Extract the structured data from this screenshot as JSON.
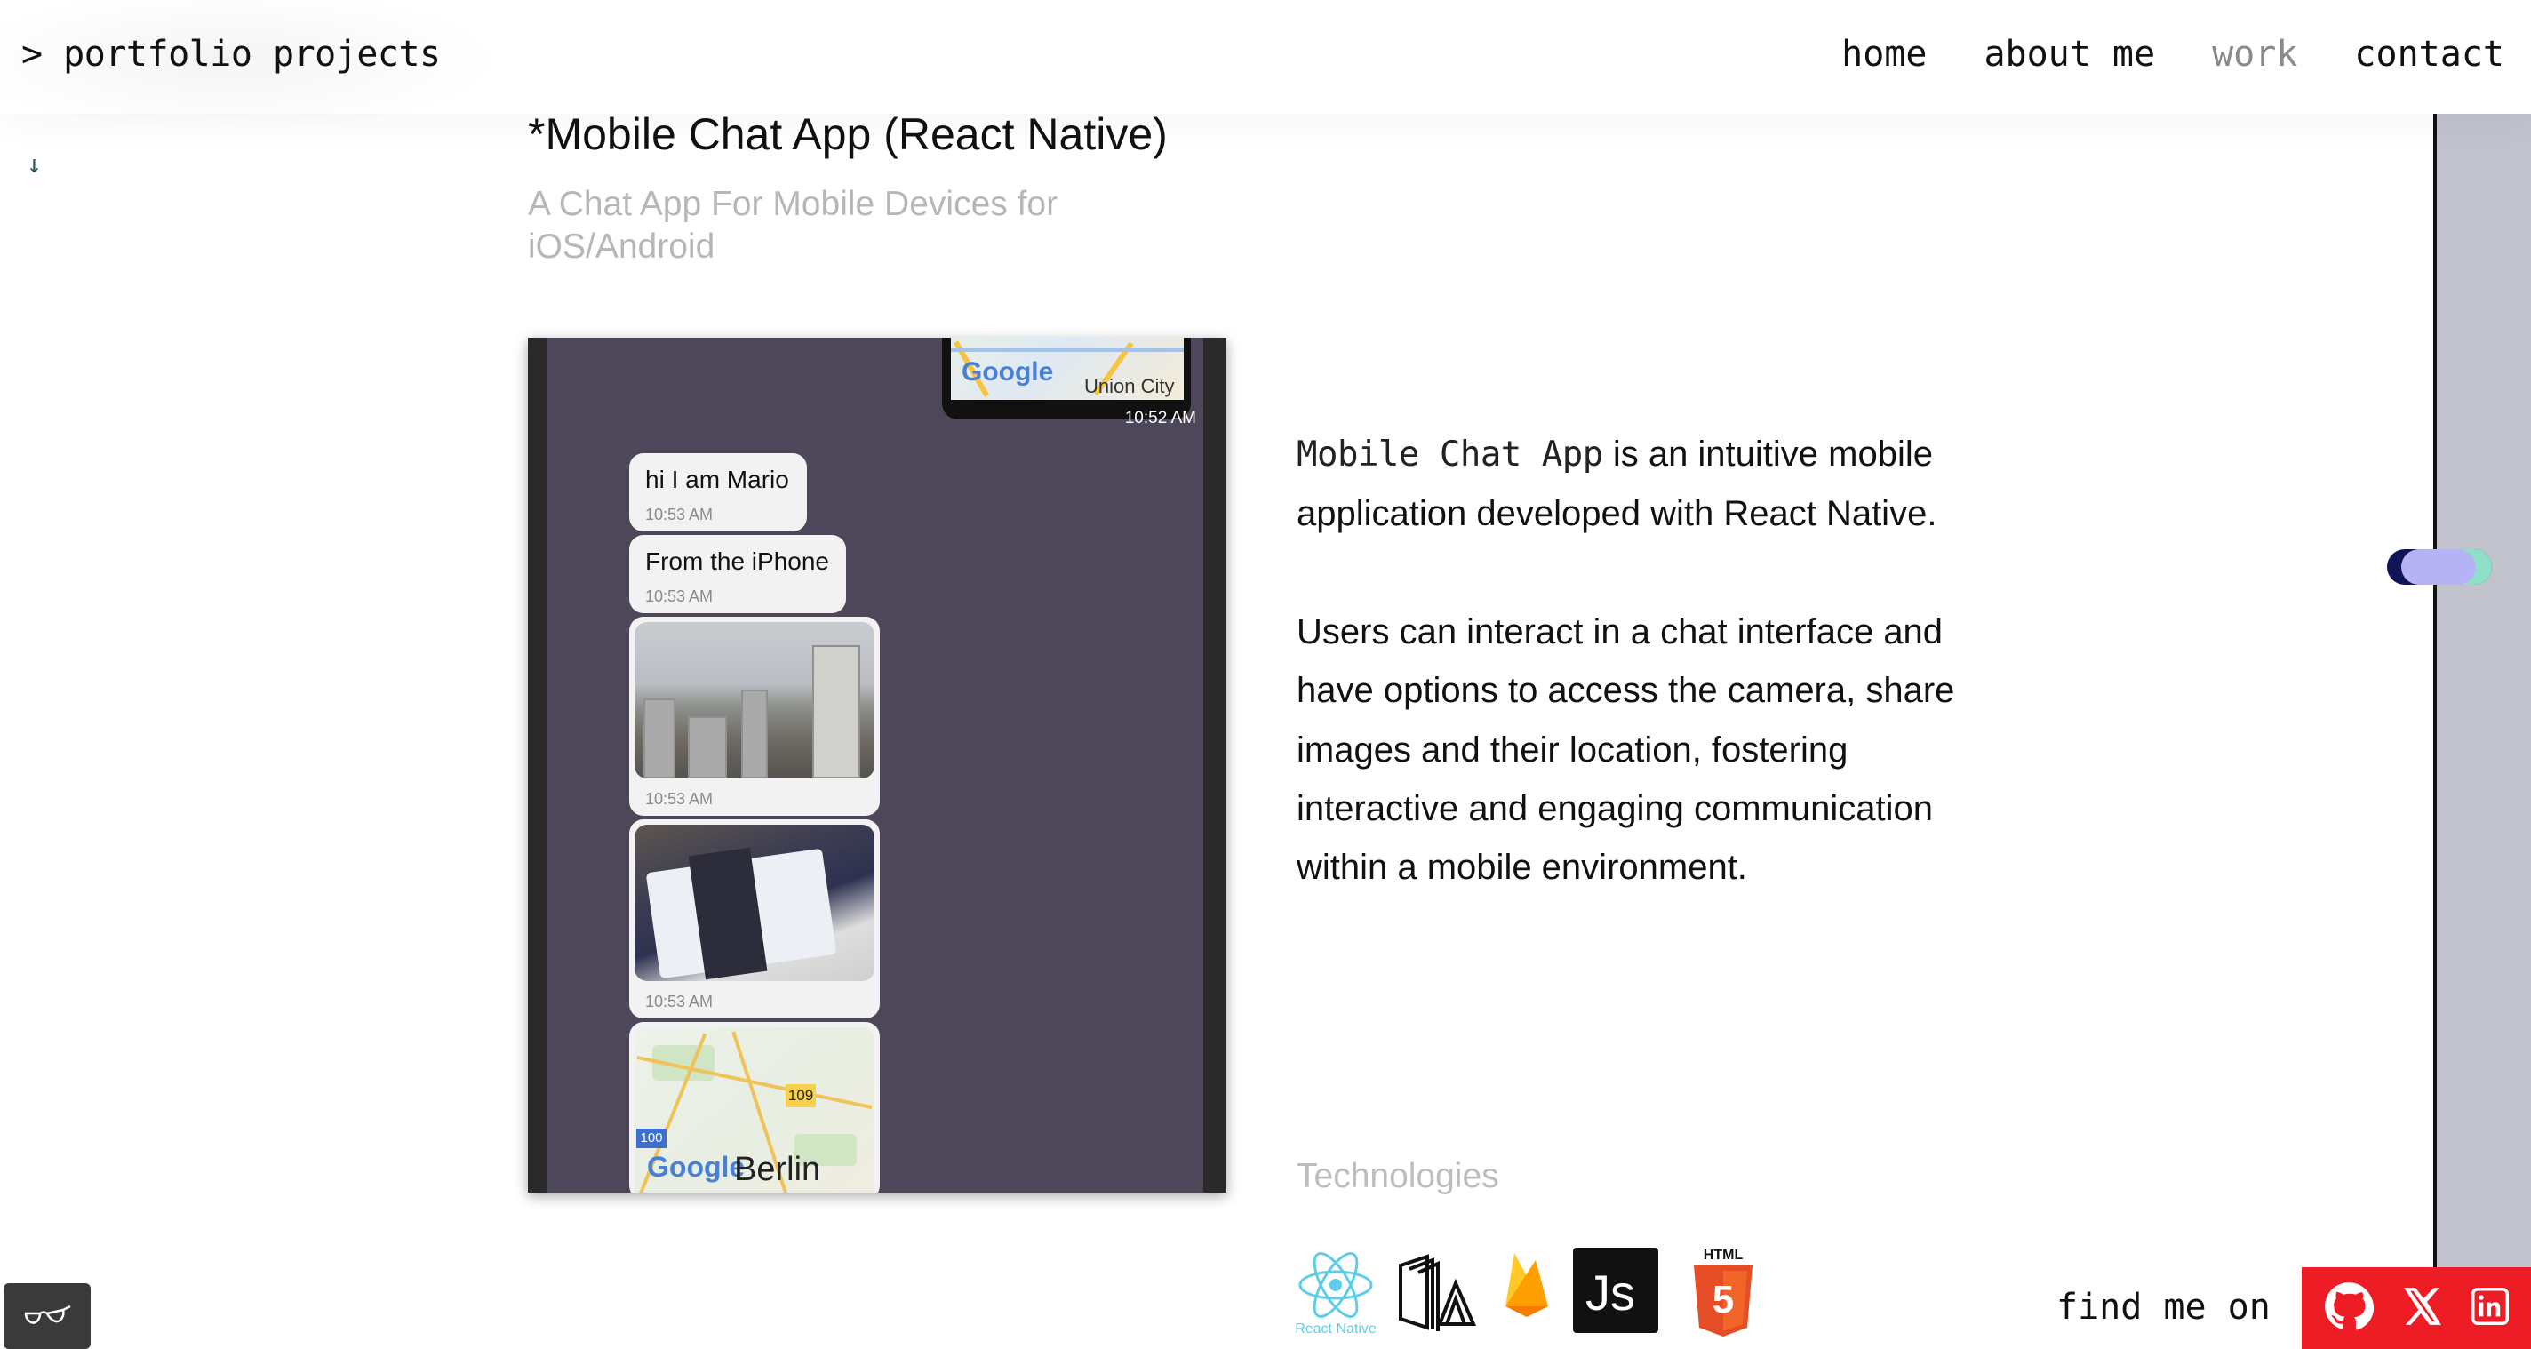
{
  "header": {
    "brand": "> portfolio projects",
    "nav": [
      {
        "label": "home"
      },
      {
        "label": "about me"
      },
      {
        "label": "work",
        "active": true
      },
      {
        "label": "contact"
      }
    ]
  },
  "cursor_glyph": "↓",
  "project": {
    "title": "*Mobile Chat App (React Native)",
    "subtitle": "A Chat App For Mobile Devices for iOS/Android",
    "description": {
      "highlight": "Mobile Chat App",
      "intro_rest": " is an intuitive mobile application developed with React Native.",
      "body": "Users can interact in a chat interface and have options to access the camera, share images and their location, fostering interactive and engaging communication within a mobile environment."
    },
    "technologies_title": "Technologies",
    "technologies": [
      {
        "name": "React Native",
        "icon": "react-icon",
        "caption": "React Native"
      },
      {
        "name": "Expo",
        "icon": "expo-icon"
      },
      {
        "name": "Firebase",
        "icon": "firebase-icon"
      },
      {
        "name": "JavaScript",
        "icon": "js-icon",
        "caption": "Js"
      },
      {
        "name": "HTML5",
        "icon": "html5-icon",
        "caption": "HTML",
        "number": "5"
      }
    ]
  },
  "screenshot": {
    "top_map_brand": "Google",
    "top_map_city": "Union City",
    "top_time": "10:52 AM",
    "messages": [
      {
        "text": "hi I am Mario",
        "time": "10:53 AM"
      },
      {
        "text": "From the iPhone",
        "time": "10:53 AM"
      },
      {
        "type": "image",
        "time": "10:53 AM"
      },
      {
        "type": "image",
        "time": "10:53 AM"
      },
      {
        "type": "map",
        "brand": "Google",
        "city": "Berlin",
        "shield": "109",
        "shield2": "100"
      }
    ]
  },
  "footer": {
    "find_me": "find me on",
    "social": [
      {
        "name": "github-icon"
      },
      {
        "name": "x-icon"
      },
      {
        "name": "linkedin-icon"
      }
    ]
  },
  "colors": {
    "accent_red": "#ee1c24",
    "rail": "#c2c2cc",
    "phone_bg": "#4e4659",
    "muted_text": "#b7b7b7"
  }
}
